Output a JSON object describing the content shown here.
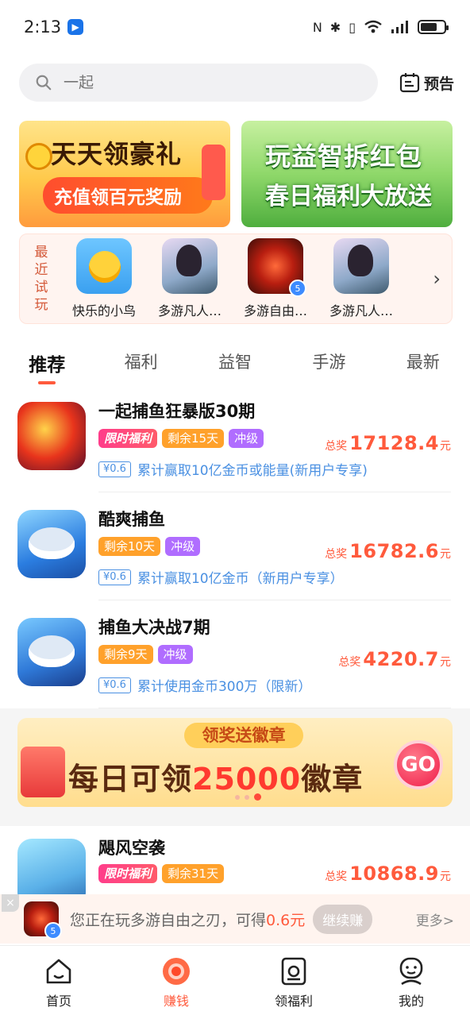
{
  "status_bar": {
    "time": "2:13",
    "app_icon": "blue-flag-icon"
  },
  "search": {
    "placeholder": "一起",
    "preview_label": "预告"
  },
  "banners": [
    {
      "line1": "天天领豪礼",
      "line2": "充值领百元奖励"
    },
    {
      "line1": "玩益智拆红包",
      "line2": "春日福利大放送"
    }
  ],
  "recent": {
    "label_chars": [
      "最",
      "近",
      "试",
      "玩"
    ],
    "items": [
      {
        "name": "快乐的小鸟",
        "icon": "yellow-bird"
      },
      {
        "name": "多游凡人…",
        "icon": "fairy-girl"
      },
      {
        "name": "多游自由…",
        "icon": "blade"
      },
      {
        "name": "多游凡人…",
        "icon": "fairy-girl"
      }
    ]
  },
  "tabs": [
    "推荐",
    "福利",
    "益智",
    "手游",
    "最新"
  ],
  "games": [
    {
      "name": "一起捕鱼狂暴版30期",
      "limited": "限时福利",
      "remain": "剩余15天",
      "level": "冲级",
      "prize_label": "总奖",
      "prize": "17128.4",
      "unit": "元",
      "price": "¥0.6",
      "task": "累计赢取10亿金币或能量(新用户专享)"
    },
    {
      "name": "酷爽捕鱼",
      "limited": "",
      "remain": "剩余10天",
      "level": "冲级",
      "prize_label": "总奖",
      "prize": "16782.6",
      "unit": "元",
      "price": "¥0.6",
      "task": "累计赢取10亿金币（新用户专享）"
    },
    {
      "name": "捕鱼大决战7期",
      "limited": "",
      "remain": "剩余9天",
      "level": "冲级",
      "prize_label": "总奖",
      "prize": "4220.7",
      "unit": "元",
      "price": "¥0.6",
      "task": "累计使用金币300万（限新）"
    },
    {
      "name": "飓风空袭",
      "limited": "限时福利",
      "remain": "剩余31天",
      "level": "",
      "prize_label": "总奖",
      "prize": "10868.9",
      "unit": "元",
      "price": "",
      "task": ""
    }
  ],
  "promo": {
    "top": "领奖送徽章",
    "main_prefix": "每日可领",
    "main_num": "25000",
    "main_suffix": "徽章",
    "go": "GO"
  },
  "playing": {
    "close": "×",
    "text": "您正在玩多游自由之刃，可得",
    "amount": "0.6元",
    "continue": "继续赚",
    "more": "更多>"
  },
  "nav": [
    {
      "label": "首页",
      "icon": "home-icon"
    },
    {
      "label": "赚钱",
      "icon": "earn-icon"
    },
    {
      "label": "领福利",
      "icon": "gift-card-icon"
    },
    {
      "label": "我的",
      "icon": "profile-icon"
    }
  ],
  "colors": {
    "accent": "#ff5a3c",
    "link": "#4a90e2",
    "remain_tag": "#ffa12b",
    "level_tag": "#b06dff"
  }
}
